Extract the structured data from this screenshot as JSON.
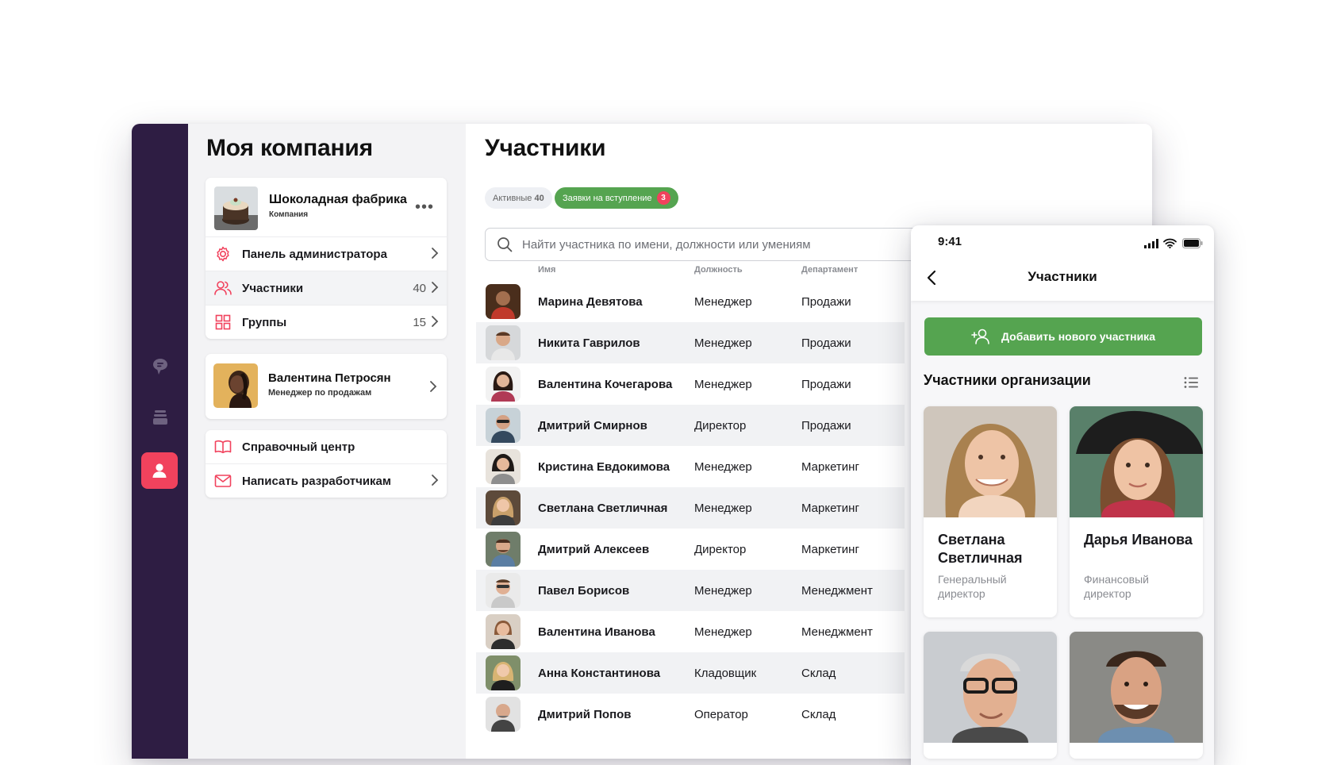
{
  "sidebar": {
    "title": "Моя компания",
    "company": {
      "name": "Шоколадная фабрика",
      "type": "Компания"
    },
    "nav": [
      {
        "label": "Панель администратора",
        "count": ""
      },
      {
        "label": "Участники",
        "count": "40"
      },
      {
        "label": "Группы",
        "count": "15"
      }
    ],
    "user": {
      "name": "Валентина Петросян",
      "role": "Менеджер по продажам"
    },
    "help": [
      {
        "label": "Справочный центр"
      },
      {
        "label": "Написать разработчикам"
      }
    ]
  },
  "main": {
    "title": "Участники",
    "tabs": {
      "active_label": "Активные",
      "active_count": "40",
      "requests_label": "Заявки на вступление",
      "requests_badge": "3"
    },
    "search": {
      "placeholder": "Найти участника по имени, должности или умениям"
    },
    "columns": {
      "name": "Имя",
      "position": "Должность",
      "department": "Департамент"
    },
    "rows": [
      {
        "name": "Марина Девятова",
        "position": "Менеджер",
        "department": "Продажи"
      },
      {
        "name": "Никита Гаврилов",
        "position": "Менеджер",
        "department": "Продажи"
      },
      {
        "name": "Валентина Кочегарова",
        "position": "Менеджер",
        "department": "Продажи"
      },
      {
        "name": "Дмитрий Смирнов",
        "position": "Директор",
        "department": "Продажи"
      },
      {
        "name": "Кристина Евдокимова",
        "position": "Менеджер",
        "department": "Маркетинг"
      },
      {
        "name": "Светлана Светличная",
        "position": "Менеджер",
        "department": "Маркетинг"
      },
      {
        "name": "Дмитрий Алексеев",
        "position": "Директор",
        "department": "Маркетинг"
      },
      {
        "name": "Павел Борисов",
        "position": "Менеджер",
        "department": "Менеджмент"
      },
      {
        "name": "Валентина Иванова",
        "position": "Менеджер",
        "department": "Менеджмент"
      },
      {
        "name": "Анна Константинова",
        "position": "Кладовщик",
        "department": "Склад"
      },
      {
        "name": "Дмитрий Попов",
        "position": "Оператор",
        "department": "Склад"
      }
    ]
  },
  "mobile": {
    "time": "9:41",
    "title": "Участники",
    "add_button": "Добавить нового участника",
    "section_title": "Участники организации",
    "cards": [
      {
        "name": "Светлана Светличная",
        "role": "Генеральный директор"
      },
      {
        "name": "Дарья Иванова",
        "role": "Финансовый директор"
      }
    ]
  },
  "colors": {
    "rail": "#2e1d43",
    "accent_red": "#f1425d",
    "accent_green": "#55a450"
  }
}
